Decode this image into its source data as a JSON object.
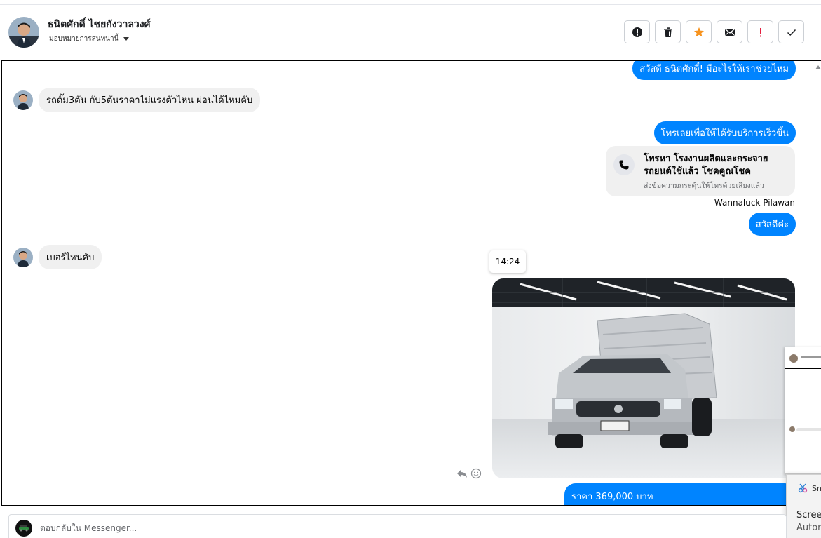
{
  "header": {
    "name": "ธนิตศักดิ์ ไชยกังวาลวงศ์",
    "assign_label": "มอบหมายการสนทนานี้",
    "toolbar": [
      {
        "name": "spam-button",
        "icon": "alert-circle-icon"
      },
      {
        "name": "delete-button",
        "icon": "trash-icon"
      },
      {
        "name": "star-button",
        "icon": "star-icon"
      },
      {
        "name": "mark-unread-button",
        "icon": "envelope-icon"
      },
      {
        "name": "important-button",
        "icon": "exclamation-icon"
      },
      {
        "name": "mark-done-button",
        "icon": "check-icon"
      }
    ]
  },
  "messages": {
    "greeting_out": "สวัสดี ธนิตศักดิ์! มีอะไรให้เราช่วยไหม",
    "question_in": "รถดั๊ม3ตัน กับ5ตันราคาไม่แรงตัวไหน ผ่อนได้ไหมคับ",
    "call_prompt_out": "โทรเลยเพื่อให้ได้รับบริการเร็วขึ้น",
    "call_card_title": "โทรหา โรงงานผลิตและกระจายรถยนต์ใช้แล้ว โชคคูณโชค",
    "call_card_sub": "ส่งข้อความกระตุ้นให้โทรด้วยเสียงแล้ว",
    "sender_name": "Wannaluck Pilawan",
    "hello_out": "สวัสดีค่ะ",
    "number_in": "เบอร์ไหนคับ",
    "timestamp": "14:24",
    "price_line": "ราคา 369,000 บาท"
  },
  "overlay": {
    "toast_app": "Sn",
    "toast_title": "Screen",
    "toast_sub": "Autom"
  },
  "composer": {
    "placeholder": "ตอบกลับใน Messenger..."
  },
  "colors": {
    "outgoing_bubble": "#0084ff",
    "incoming_bubble": "#f0f0f0",
    "star": "#f7931e",
    "important": "#e41e3f"
  }
}
